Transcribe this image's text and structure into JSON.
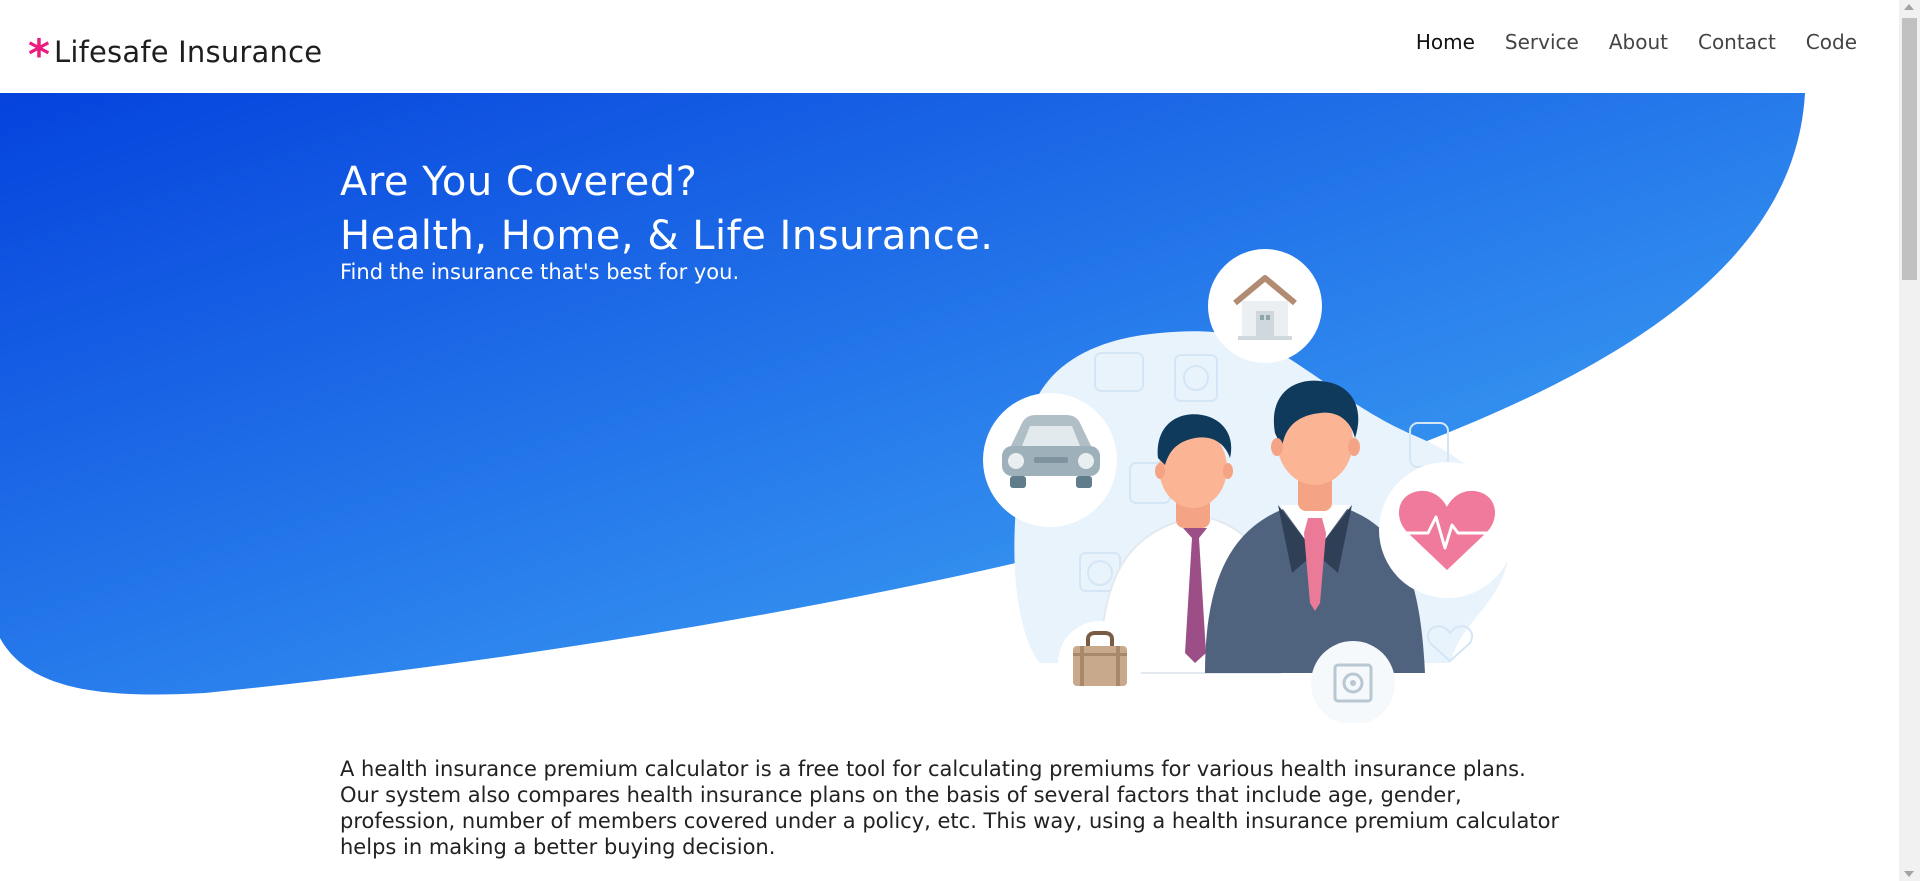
{
  "brand": {
    "name": "Lifesafe Insurance",
    "star": "*",
    "accent_color": "#ec1c7f"
  },
  "nav": {
    "items": [
      {
        "label": "Home",
        "active": true
      },
      {
        "label": "Service",
        "active": false
      },
      {
        "label": "About",
        "active": false
      },
      {
        "label": "Contact",
        "active": false
      },
      {
        "label": "Code",
        "active": false
      }
    ]
  },
  "hero": {
    "title_line1": "Are You Covered?",
    "title_line2": "Health, Home, & Life Insurance.",
    "subtitle": "Find the insurance that's best for you.",
    "gradient_start": "#0543dd",
    "gradient_end": "#3ea2f1",
    "illustration_icons": [
      "house-icon",
      "car-icon",
      "heart-pulse-icon",
      "briefcase-icon",
      "safe-icon"
    ]
  },
  "intro": {
    "text": "A health insurance premium calculator is a free tool for calculating premiums for various health insurance plans. Our system also compares health insurance plans on the basis of several factors that include age, gender, profession, number of members covered under a policy, etc. This way, using a health insurance premium calculator helps in making a better buying decision."
  }
}
